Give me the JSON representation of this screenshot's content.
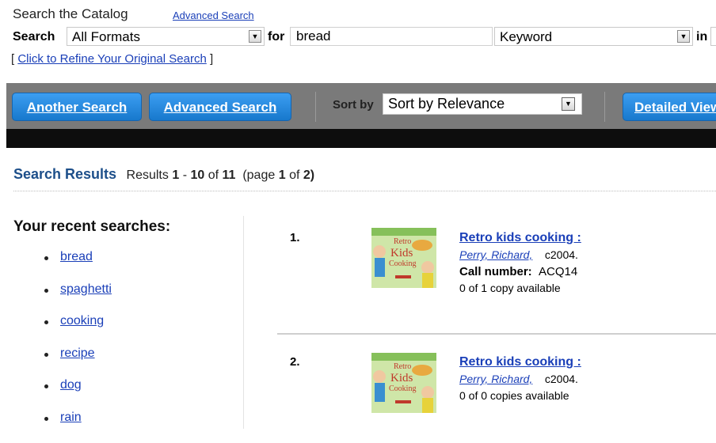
{
  "search_form": {
    "title": "Search the Catalog",
    "advanced_link": "Advanced Search",
    "search_label": "Search",
    "format_value": "All Formats",
    "for_label": "for",
    "term_value": "bread",
    "type_value": "Keyword",
    "in_label": "in",
    "refine_open": "[ ",
    "refine_link": "Click to Refine Your Original Search",
    "refine_close": " ]"
  },
  "toolbar": {
    "another_search": "Another Search",
    "advanced_search": "Advanced Search",
    "sort_by_label": "Sort by",
    "sort_value": "Sort by Relevance",
    "detailed_view": "Detailed View"
  },
  "results_header": {
    "title": "Search Results",
    "results_label": "Results",
    "start": "1",
    "dash": "-",
    "end": "10",
    "of_label": "of",
    "total": "11",
    "page_open": "(page",
    "page": "1",
    "page_of": "of",
    "pages": "2)"
  },
  "recent": {
    "title": "Your recent searches:",
    "items": [
      "bread",
      "spaghetti",
      "cooking",
      "recipe",
      "dog",
      "rain"
    ]
  },
  "results": [
    {
      "number": "1.",
      "title": "Retro kids cooking :",
      "author": "Perry, Richard,",
      "date": "c2004.",
      "call_label": "Call number:",
      "call_number": "ACQ14",
      "availability": "0 of 1 copy available"
    },
    {
      "number": "2.",
      "title": "Retro kids cooking :",
      "author": "Perry, Richard,",
      "date": "c2004.",
      "availability": "0 of 0 copies available"
    }
  ],
  "colors": {
    "button_blue": "#1e86e0",
    "toolbar_gray": "#7a7a7a",
    "link_blue": "#1a3fb8",
    "heading_blue": "#1d4f8a"
  },
  "icons": [
    "dropdown-arrow-icon",
    "bullet-icon",
    "book-cover-icon"
  ]
}
